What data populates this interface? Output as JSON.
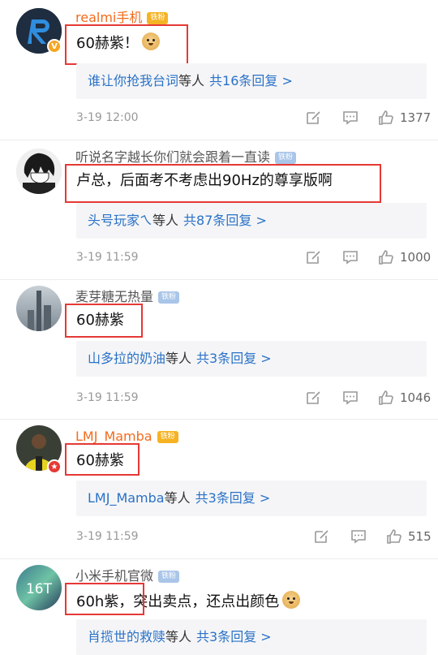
{
  "comments": [
    {
      "username": "realmi手机",
      "badge": "铁粉",
      "text": "60赫紫！",
      "reply_who": "谁让你抢我台词",
      "reply_suffix": "等人",
      "reply_count": "共16条回复 >",
      "time": "3-19 12:00",
      "likes": "1377"
    },
    {
      "username": "听说名字越长你们就会跟着一直读",
      "badge": "铁粉",
      "text": "卢总，后面考不考虑出90Hz的尊享版啊",
      "reply_who": "头号玩家ㄟ",
      "reply_suffix": "等人",
      "reply_count": "共87条回复 >",
      "time": "3-19 11:59",
      "likes": "1000"
    },
    {
      "username": "麦芽糖无热量",
      "badge": "铁粉",
      "text": "60赫紫",
      "reply_who": "山多拉的奶油",
      "reply_suffix": "等人",
      "reply_count": "共3条回复 >",
      "time": "3-19 11:59",
      "likes": "1046"
    },
    {
      "username": "LMJ_Mamba",
      "badge": "铁粉",
      "text": "60赫紫",
      "reply_who": "LMJ_Mamba",
      "reply_suffix": "等人",
      "reply_count": "共3条回复 >",
      "time": "3-19 11:59",
      "likes": "515"
    },
    {
      "username": "小米手机官微",
      "badge": "铁粉",
      "text": "60h紫，突出卖点，还点出颜色",
      "reply_who": "肖揽世的救赎",
      "reply_suffix": "等人",
      "reply_count": "共3条回复 >",
      "time": "",
      "likes": ""
    }
  ],
  "avatar5_label": "16T",
  "colors": {
    "link": "#2a72c7",
    "orange_name": "#f26b1d",
    "highlight_box": "#e53935"
  }
}
